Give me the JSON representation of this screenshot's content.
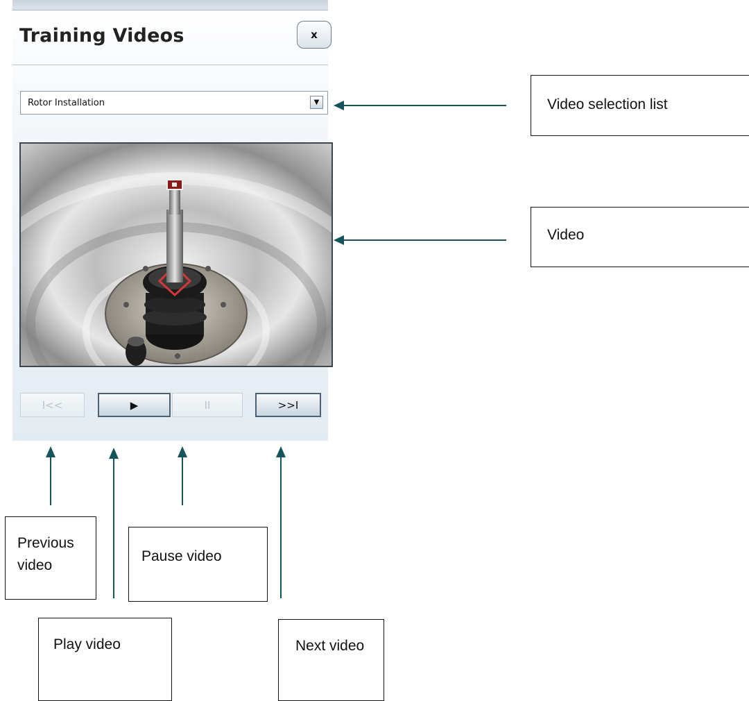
{
  "panel": {
    "title": "Training Videos",
    "close_label": "x",
    "video_select": {
      "selected": "Rotor Installation"
    },
    "controls": {
      "previous_label": "I<<",
      "play_label": "▶",
      "pause_label": "II",
      "next_label": ">>I"
    }
  },
  "annotations": {
    "video_selection_list": "Video selection list",
    "video": "Video",
    "previous_video": "Previous video",
    "pause_video": "Pause video",
    "play_video": "Play video",
    "next_video": "Next video"
  },
  "colors": {
    "arrow": "#14555b",
    "panel_border": "#6f7c88"
  }
}
